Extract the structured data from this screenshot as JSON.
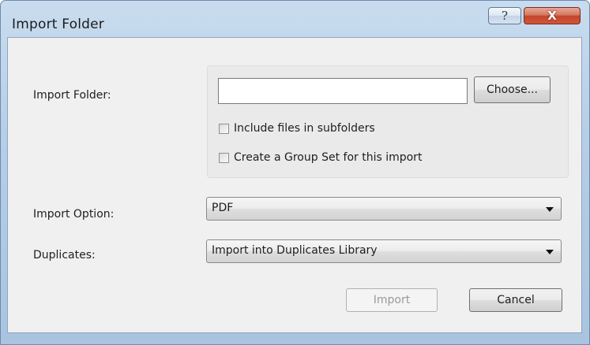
{
  "window": {
    "title": "Import Folder",
    "help_label": "?",
    "close_label": "X"
  },
  "form": {
    "import_folder_label": "Import Folder:",
    "folder_path_value": "",
    "choose_label": "Choose...",
    "include_subfolders_label": "Include files in subfolders",
    "include_subfolders_checked": false,
    "create_group_set_label": "Create a Group Set for this import",
    "create_group_set_checked": false,
    "import_option_label": "Import Option:",
    "import_option_value": "PDF",
    "duplicates_label": "Duplicates:",
    "duplicates_value": "Import into Duplicates Library"
  },
  "buttons": {
    "import_label": "Import",
    "import_enabled": false,
    "cancel_label": "Cancel"
  },
  "icons": {
    "help": "help-icon",
    "close": "close-icon",
    "dropdown": "chevron-down-icon"
  },
  "colors": {
    "titlebar": "#b6cee6",
    "close_button": "#c2462c",
    "dialog_background": "#f0f0f0"
  }
}
